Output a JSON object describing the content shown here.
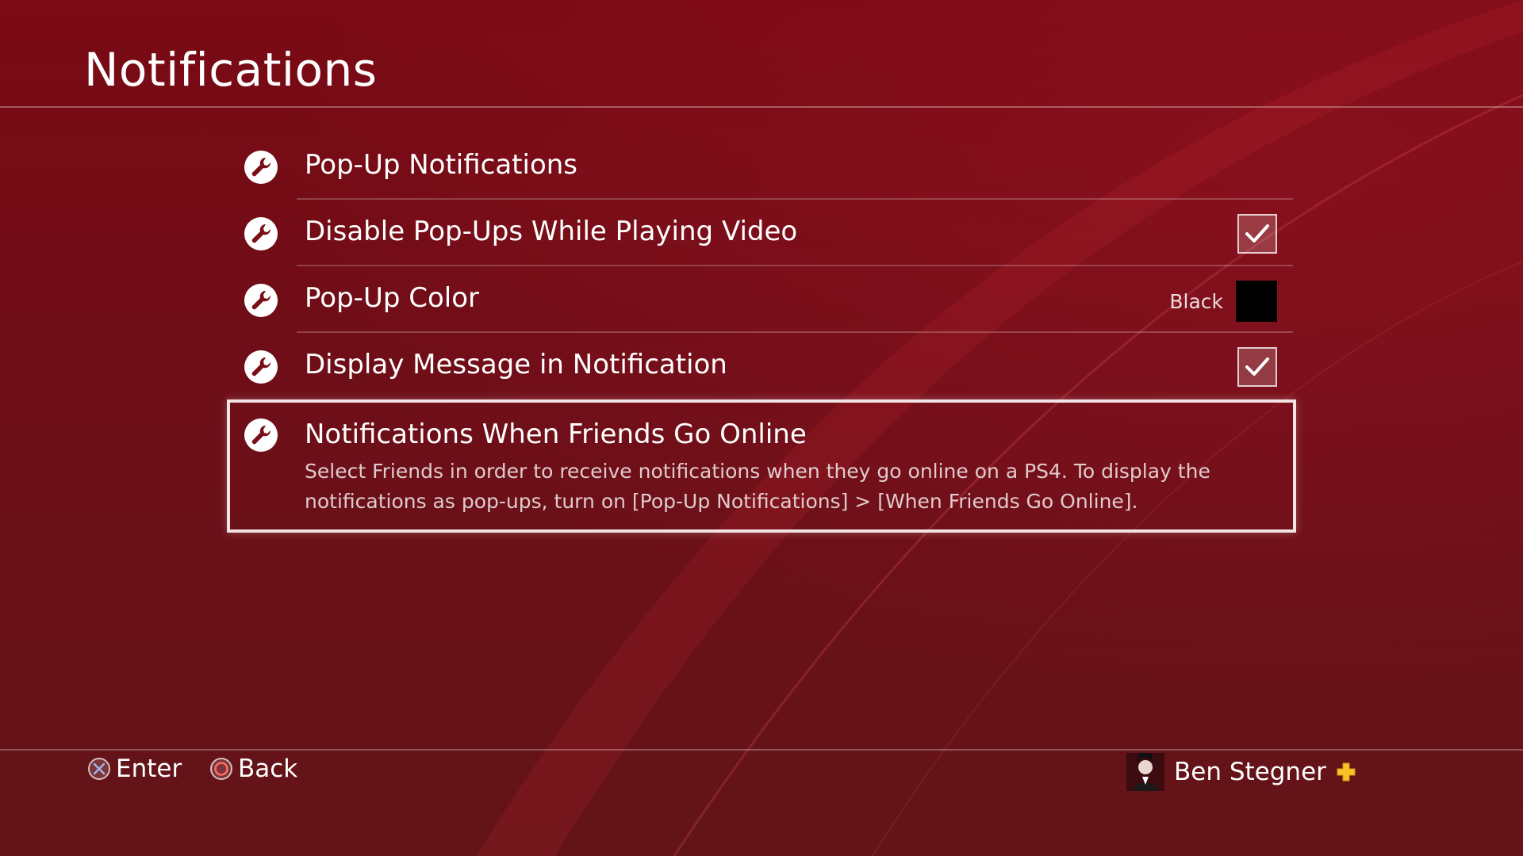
{
  "header": {
    "title": "Notifications"
  },
  "menu": {
    "items": [
      {
        "label": "Pop-Up Notifications",
        "icon": "wrench-icon"
      },
      {
        "label": "Disable Pop-Ups While Playing Video",
        "icon": "wrench-icon",
        "checked": true
      },
      {
        "label": "Pop-Up Color",
        "icon": "wrench-icon",
        "value": "Black",
        "swatch_color": "#000000"
      },
      {
        "label": "Display Message in Notification",
        "icon": "wrench-icon",
        "checked": true
      },
      {
        "label": "Notifications When Friends Go Online",
        "icon": "wrench-icon",
        "selected": true,
        "description": "Select Friends in order to receive notifications when they go online on a PS4. To display the notifications as pop-ups, turn on [Pop-Up Notifications] > [When Friends Go Online]."
      }
    ]
  },
  "footer": {
    "enter_label": "Enter",
    "enter_icon": "cross-button-icon",
    "back_label": "Back",
    "back_icon": "circle-button-icon",
    "user_name": "Ben Stegner",
    "user_badge_icon": "ps-plus-icon",
    "plus_color": "#f6c22a"
  },
  "theme": {
    "background": "#6e0e18",
    "accent": "#ffffff"
  }
}
